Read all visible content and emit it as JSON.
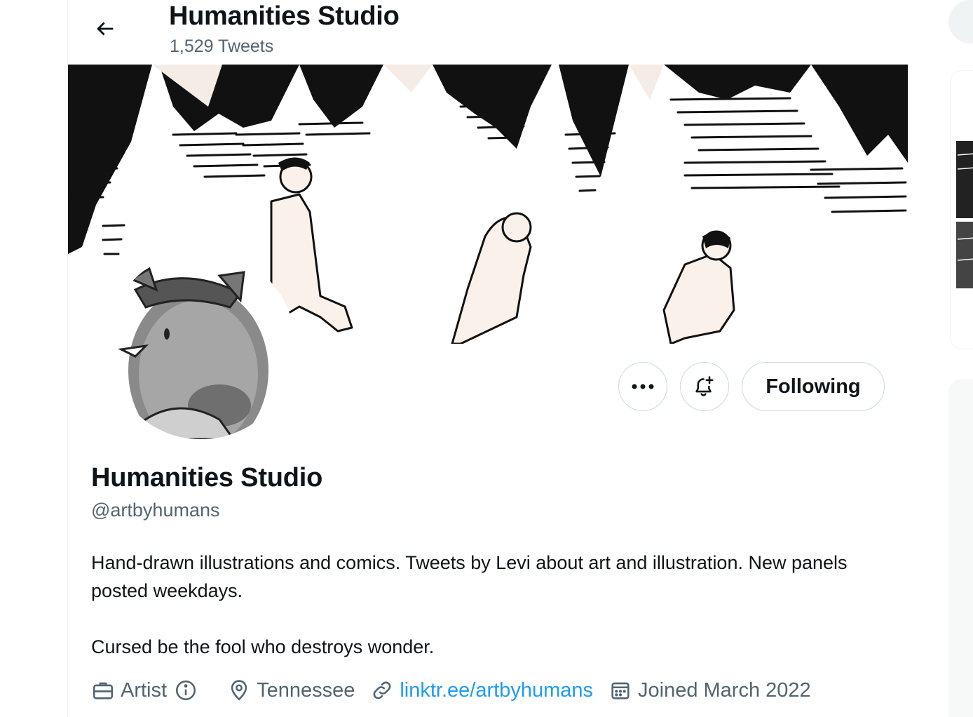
{
  "header": {
    "title": "Humanities Studio",
    "tweet_count": "1,529 Tweets"
  },
  "profile": {
    "name": "Humanities Studio",
    "handle": "@artbyhumans",
    "bio_line1": "Hand-drawn illustrations and comics. Tweets by Levi about art and illustration. New panels posted weekdays.",
    "bio_line2": "Cursed be the fool who destroys wonder.",
    "category": "Artist",
    "location": "Tennessee",
    "website": "linktr.ee/artbyhumans",
    "joined": "Joined March 2022"
  },
  "actions": {
    "following_label": "Following"
  },
  "icons": {
    "back": "arrow-left-icon",
    "more": "more-dots-icon",
    "notify": "bell-plus-icon",
    "category": "briefcase-icon",
    "info": "info-icon",
    "location": "location-pin-icon",
    "link": "link-icon",
    "calendar": "calendar-icon"
  },
  "colors": {
    "text": "#0f1419",
    "secondary": "#536471",
    "link": "#1d9bf0",
    "border": "#cfd9de"
  }
}
